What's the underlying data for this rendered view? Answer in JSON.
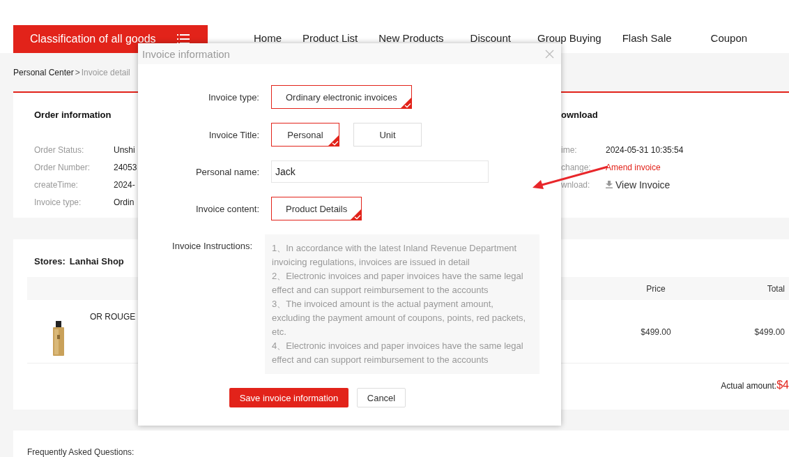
{
  "header": {
    "category_button": "Classification of all goods",
    "nav": [
      "Home",
      "Product List",
      "New Products",
      "Discount",
      "Group Buying",
      "Flash Sale",
      "Coupon"
    ]
  },
  "breadcrumb": {
    "parent": "Personal Center",
    "separator": ">",
    "current": "Invoice detail"
  },
  "order_card": {
    "title": "Order information",
    "rows": [
      {
        "label": "Order Status:",
        "value": "Unshi"
      },
      {
        "label": "Order Number:",
        "value": "24053"
      },
      {
        "label": "createTime:",
        "value": "2024-"
      },
      {
        "label": "Invoice type:",
        "value": "Ordin"
      }
    ],
    "invoice_title": "ownload",
    "invoice_rows": [
      {
        "label": "ime:",
        "value": "2024-05-31 10:35:54",
        "kind": "text"
      },
      {
        "label": "change:",
        "value": "Amend invoice",
        "kind": "link"
      },
      {
        "label": "wnload:",
        "value": "View Invoice",
        "kind": "download"
      }
    ]
  },
  "store_card": {
    "store_label": "Stores:",
    "store_name": "Lanhai Shop",
    "columns": [
      "Price",
      "Total"
    ],
    "rows": [
      {
        "name": "OR ROUGE",
        "price": "$499.00",
        "total": "$499.00"
      }
    ],
    "actual_label": "Actual amount:",
    "actual_value": "$4"
  },
  "faq": {
    "title": "Frequently Asked Questions:"
  },
  "dialog": {
    "title": "Invoice information",
    "fields": [
      {
        "kind": "options",
        "label": "Invoice type:",
        "options": [
          {
            "label": "Ordinary electronic invoices",
            "selected": true
          }
        ]
      },
      {
        "kind": "options",
        "label": "Invoice Title:",
        "options": [
          {
            "label": "Personal",
            "selected": true
          },
          {
            "label": "Unit",
            "selected": false
          }
        ]
      },
      {
        "kind": "input",
        "label": "Personal name:",
        "value": "Jack"
      },
      {
        "kind": "options",
        "label": "Invoice content:",
        "options": [
          {
            "label": "Product Details",
            "selected": true
          }
        ]
      }
    ],
    "instructions_label": "Invoice Instructions:",
    "instructions": [
      "1、In accordance with the latest Inland Revenue Department invoicing regulations, invoices are issued in detail",
      "2、Electronic invoices and paper invoices have the same legal effect and can support reimbursement to the accounts",
      "3、The invoiced amount is the actual payment amount, excluding the payment amount of coupons, points, red packets, etc.",
      "4、Electronic invoices and paper invoices have the same legal effect and can support reimbursement to the accounts"
    ],
    "buttons": [
      {
        "label": "Save invoice information",
        "kind": "primary"
      },
      {
        "label": "Cancel",
        "kind": "secondary"
      }
    ]
  }
}
